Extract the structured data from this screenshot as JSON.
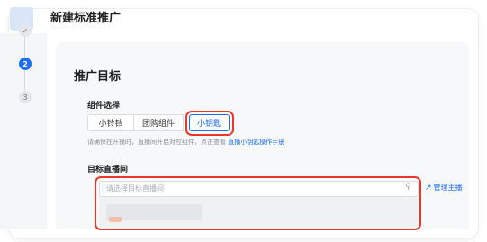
{
  "header": {
    "title": "新建标准推广"
  },
  "steps": [
    {
      "label": "✓",
      "state": "done"
    },
    {
      "label": "2",
      "state": "active"
    },
    {
      "label": "3",
      "state": "pending"
    }
  ],
  "section": {
    "title": "推广目标"
  },
  "component": {
    "label": "组件选择",
    "options": [
      "小铃铛",
      "团购组件",
      "小钥匙"
    ],
    "selected": "小钥匙",
    "hint": "请确保在开播时，直播间开启对应组件，点击查看 ",
    "hint_link": "直播小钥匙操作手册"
  },
  "room": {
    "label": "目标直播间",
    "placeholder": "请选择目标直播间",
    "manage_label": "管理主播"
  },
  "colors": {
    "accent": "#1f6ff2",
    "highlight": "#e8372d"
  },
  "icons": {
    "search": "search-icon",
    "manage": "external-link-icon"
  }
}
